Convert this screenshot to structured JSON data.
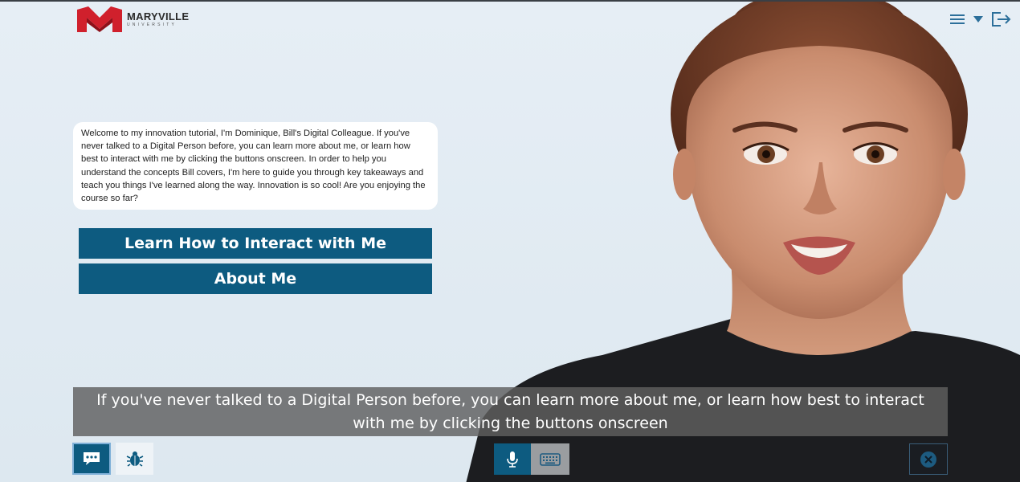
{
  "brand": {
    "name": "MARYVILLE",
    "subtitle": "UNIVERSITY",
    "accent_color": "#d0202c"
  },
  "top_controls": {
    "menu_icon": "menu-icon",
    "dropdown_icon": "caret-down-icon",
    "exit_icon": "exit-icon"
  },
  "speech_bubble": {
    "text": "Welcome to my innovation tutorial, I'm Dominique, Bill's Digital Colleague. If you've never talked to a Digital Person before, you can learn more about me, or learn how best to interact with me by clicking the buttons onscreen. In order to help you understand the concepts Bill covers, I'm here to guide you through key takeaways and teach you things I've learned along the way. Innovation is so cool! Are you enjoying the course so far?"
  },
  "options": {
    "learn_label": "Learn How to Interact with Me",
    "about_label": "About Me"
  },
  "subtitle": {
    "text": "If you've never talked to a Digital Person before, you can learn more about me, or learn how best to interact with me by clicking the buttons onscreen"
  },
  "bottom_controls": {
    "chat_icon": "chat-icon",
    "bug_icon": "bug-icon",
    "mic_icon": "microphone-icon",
    "keyboard_icon": "keyboard-icon",
    "close_icon": "close-icon"
  },
  "colors": {
    "button_bg": "#0d5b80",
    "background": "#dfe9f1"
  }
}
